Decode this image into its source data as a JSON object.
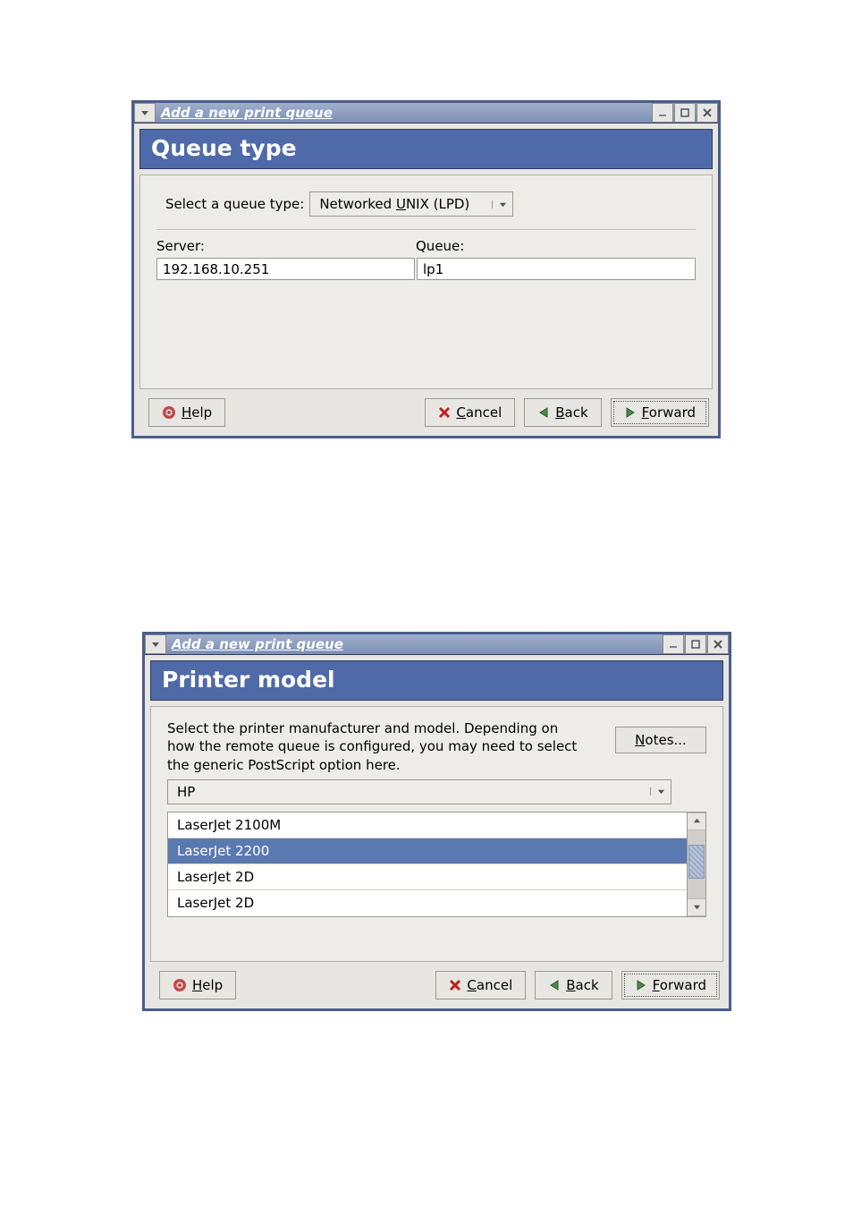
{
  "dialogs": [
    {
      "titlebar": {
        "title": "Add a new print queue"
      },
      "banner": "Queue type",
      "queue_type": {
        "label": "Select a queue type:",
        "select_text_pre": "Networked ",
        "select_mnemonic": "U",
        "select_text_post": "NIX (LPD)"
      },
      "server": {
        "label": "Server:",
        "value": "192.168.10.251"
      },
      "queue": {
        "label": "Queue:",
        "value": "lp1"
      },
      "buttons": {
        "help_mnemonic": "H",
        "help_post": "elp",
        "cancel_mnemonic": "C",
        "cancel_post": "ancel",
        "back_mnemonic": "B",
        "back_post": "ack",
        "forward_mnemonic": "F",
        "forward_post": "orward"
      }
    },
    {
      "titlebar": {
        "title": "Add a new print queue"
      },
      "banner": "Printer model",
      "description": "Select the printer manufacturer and model. Depending on how the remote queue is configured, you may need to select the generic PostScript option here.",
      "notes_mnemonic": "N",
      "notes_post": "otes...",
      "manufacturer": {
        "value": "HP"
      },
      "models": {
        "items": [
          "LaserJet 2100M",
          "LaserJet 2200",
          "LaserJet 2D",
          "LaserJet 2D"
        ],
        "selected_index": 1
      },
      "buttons": {
        "help_mnemonic": "H",
        "help_post": "elp",
        "cancel_mnemonic": "C",
        "cancel_post": "ancel",
        "back_mnemonic": "B",
        "back_post": "ack",
        "forward_mnemonic": "F",
        "forward_post": "orward"
      }
    }
  ]
}
